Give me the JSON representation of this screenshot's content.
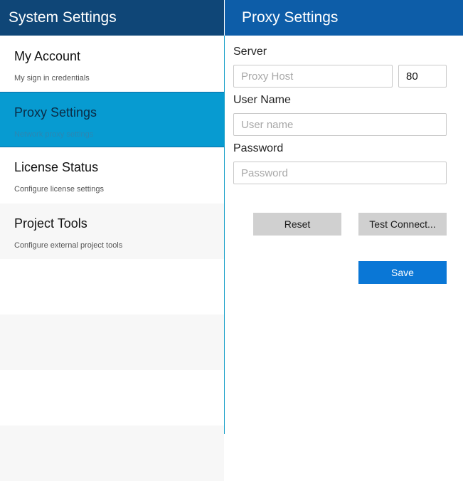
{
  "sidebar": {
    "title": "System Settings",
    "items": [
      {
        "label": "My Account",
        "description": "My sign in credentials",
        "selected": false
      },
      {
        "label": "Proxy Settings",
        "description": "Network proxy settings",
        "selected": true
      },
      {
        "label": "License Status",
        "description": "Configure license settings",
        "selected": false
      },
      {
        "label": "Project Tools",
        "description": "Configure external project tools",
        "selected": false
      }
    ]
  },
  "panel": {
    "title": "Proxy Settings",
    "server_label": "Server",
    "host_placeholder": "Proxy Host",
    "host_value": "",
    "port_value": "80",
    "username_label": "User Name",
    "username_placeholder": "User name",
    "username_value": "",
    "password_label": "Password",
    "password_placeholder": "Password",
    "password_value": "",
    "reset_label": "Reset",
    "test_label": "Test Connect...",
    "save_label": "Save"
  },
  "colors": {
    "sidebar_header": "#0f4677",
    "panel_header": "#0d5da8",
    "selected_item": "#079bd1",
    "save_button": "#0a77d6"
  }
}
